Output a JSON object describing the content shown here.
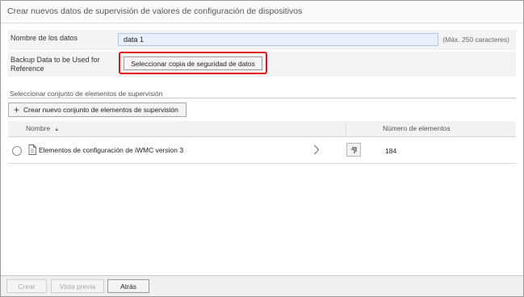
{
  "dialog": {
    "title": "Crear nuevos datos de supervisión de valores de configuración de dispositivos"
  },
  "form": {
    "name_label": "Nombre de los datos",
    "name_value": "data 1",
    "name_hint": "(Máx. 250 caracteres)",
    "backup_label": "Backup Data to be Used for Reference",
    "backup_button": "Seleccionar copia de seguridad de datos",
    "highlight_color": "#e0141e"
  },
  "monitoring_set": {
    "section_label": "Seleccionar conjunto de elementos de supervisión",
    "create_button": "Crear nuevo conjunto de elementos de supervisión",
    "columns": {
      "name": "Nombre",
      "count": "Número de elementos"
    },
    "rows": [
      {
        "label": "Elementos de configuración de iWMC version 3",
        "count": "184"
      }
    ]
  },
  "footer": {
    "create": "Crear",
    "preview": "Vista previa",
    "back": "Atrás"
  }
}
